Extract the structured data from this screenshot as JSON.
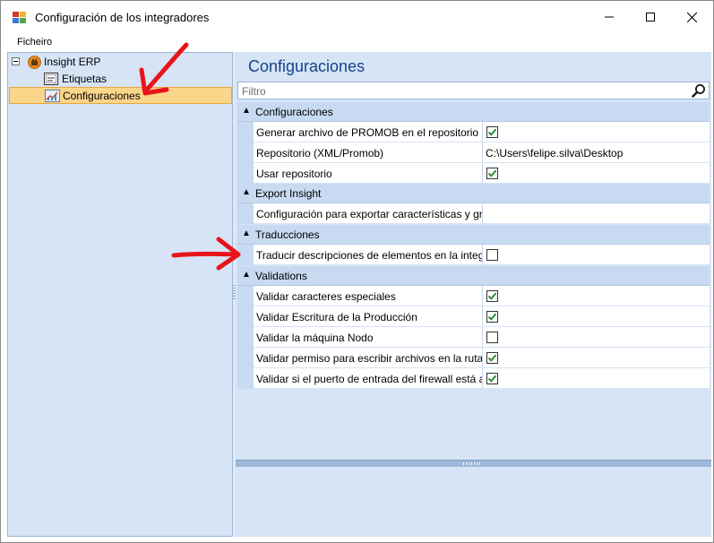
{
  "window": {
    "title": "Configuración de los integradores",
    "controls": [
      "minimize",
      "maximize",
      "close"
    ]
  },
  "menu": {
    "items": [
      {
        "label": "Ficheiro"
      }
    ]
  },
  "tree": {
    "root": {
      "label": "Insight ERP",
      "icon": "erp-icon",
      "expanded": true
    },
    "children": [
      {
        "label": "Etiquetas",
        "icon": "label-icon",
        "selected": false
      },
      {
        "label": "Configuraciones",
        "icon": "chart-icon",
        "selected": true
      }
    ]
  },
  "panel": {
    "title": "Configuraciones",
    "filter": {
      "placeholder": "Filtro",
      "value": ""
    }
  },
  "grid": {
    "categories": [
      {
        "label": "Configuraciones",
        "properties": [
          {
            "name": "Generar archivo de PROMOB en el repositorio",
            "type": "checkbox",
            "checked": true
          },
          {
            "name": "Repositorio (XML/Promob)",
            "type": "text",
            "value": "C:\\Users\\felipe.silva\\Desktop"
          },
          {
            "name": "Usar repositorio",
            "type": "checkbox",
            "checked": true
          }
        ]
      },
      {
        "label": "Export Insight",
        "properties": [
          {
            "name": "Configuración para exportar características y gru...",
            "type": "text",
            "value": ""
          }
        ]
      },
      {
        "label": "Traducciones",
        "properties": [
          {
            "name": "Traducir descripciones de elementos en la integr...",
            "type": "checkbox",
            "checked": false
          }
        ]
      },
      {
        "label": "Validations",
        "properties": [
          {
            "name": "Validar caracteres especiales",
            "type": "checkbox",
            "checked": true
          },
          {
            "name": "Validar Escritura de la Producción",
            "type": "checkbox",
            "checked": true
          },
          {
            "name": "Validar la máquina Nodo",
            "type": "checkbox",
            "checked": false
          },
          {
            "name": "Validar permiso para escribir archivos en la ruta...",
            "type": "checkbox",
            "checked": true
          },
          {
            "name": "Validar si el puerto de entrada del firewall está a...",
            "type": "checkbox",
            "checked": true
          }
        ]
      }
    ]
  },
  "colors": {
    "pane_bg": "#d6e4f5",
    "category_bg": "#c7daf1",
    "selection_bg": "#fbd58a",
    "title_blue": "#15428b",
    "annotation_red": "#e8141b",
    "check_green": "#2f8a3a"
  }
}
